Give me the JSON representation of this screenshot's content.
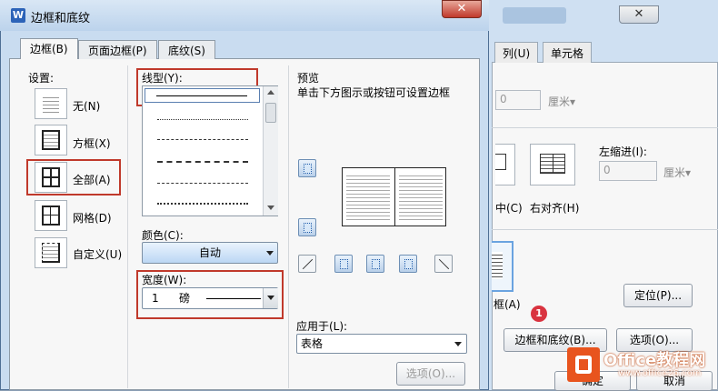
{
  "background_dialog": {
    "tabs": [
      "列(U)",
      "单元格"
    ],
    "spin_value_1": "0",
    "unit_1": "厘米▾",
    "indent_label": "左缩进(I):",
    "spin_value_2": "0",
    "unit_2": "厘米▾",
    "align_right_label": "右对齐(H)",
    "partial_label_1": "中(C)",
    "partial_label_2": "框(A)",
    "position_button": "定位(P)...",
    "borders_button": "边框和底纹(B)...",
    "options_button": "选项(O)...",
    "ok_button": "确定",
    "cancel_button": "取消",
    "step_badge": "1",
    "watermark_main": "Office教程网",
    "watermark_sub": "www.office26.com"
  },
  "dialog": {
    "title": "边框和底纹",
    "close_glyph": "✕",
    "tabs": [
      "边框(B)",
      "页面边框(P)",
      "底纹(S)"
    ],
    "settings": {
      "label": "设置:",
      "items": [
        "无(N)",
        "方框(X)",
        "全部(A)",
        "网格(D)",
        "自定义(U)"
      ]
    },
    "line_style_label": "线型(Y):",
    "color_label": "颜色(C):",
    "color_value": "自动",
    "width_label": "宽度(W):",
    "width_value": "1",
    "width_unit": "磅",
    "preview": {
      "label": "预览",
      "hint": "单击下方图示或按钮可设置边框"
    },
    "apply_to_label": "应用于(L):",
    "apply_to_value": "表格",
    "options_button": "选项(O)..."
  }
}
